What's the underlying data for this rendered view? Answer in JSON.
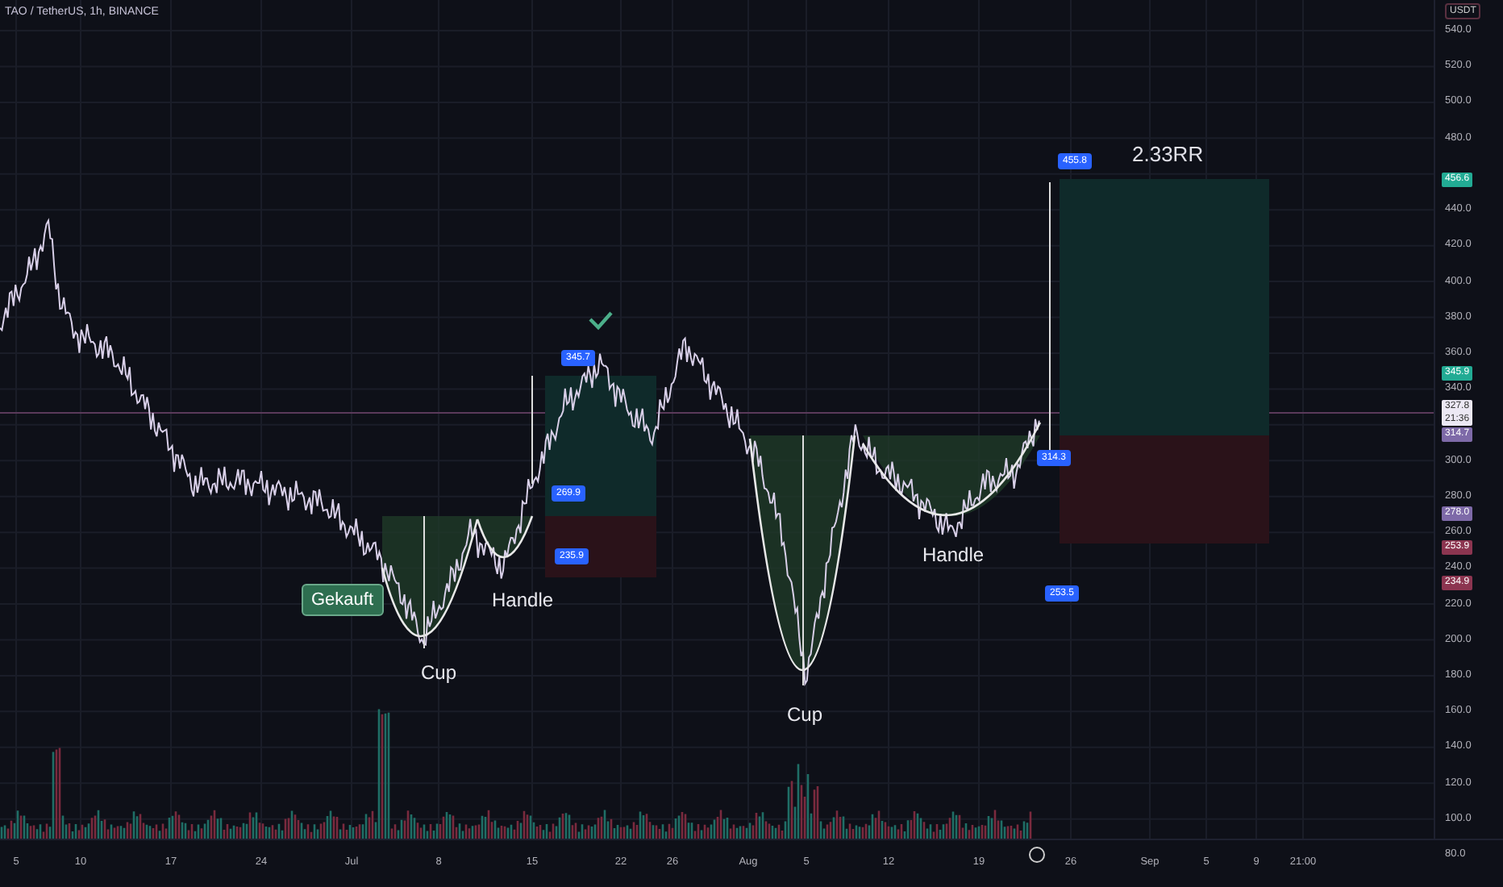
{
  "chart": {
    "title": "TAO / TetherUS, 1h, BINANCE",
    "rr_label": "2.33RR"
  },
  "price_axis": {
    "unit": "USDT",
    "ticks": [
      "540.0",
      "520.0",
      "500.0",
      "480.0",
      "440.0",
      "420.0",
      "400.0",
      "380.0",
      "360.0",
      "340.0",
      "300.0",
      "280.0",
      "260.0",
      "240.0",
      "220.0",
      "200.0",
      "180.0",
      "160.0",
      "140.0",
      "120.0",
      "100.0",
      "80.0"
    ],
    "badges": [
      {
        "text": "456.6",
        "color": "#22ab94"
      },
      {
        "text": "345.9",
        "color": "#22ab94"
      },
      {
        "text": "327.8",
        "subtext": "21:36",
        "color": "#ece8f4"
      },
      {
        "text": "314.7",
        "color": "#7e6aa8"
      },
      {
        "text": "278.0",
        "color": "#7e6aa8"
      },
      {
        "text": "253.9",
        "color": "#8c3550"
      },
      {
        "text": "234.9",
        "color": "#8c3550"
      }
    ]
  },
  "time_axis": {
    "ticks": [
      "5",
      "10",
      "17",
      "24",
      "Jul",
      "8",
      "15",
      "22",
      "26",
      "Aug",
      "5",
      "12",
      "19",
      "26",
      "Sep",
      "5",
      "9",
      "21:00"
    ]
  },
  "price_labels": [
    "345.7",
    "269.9",
    "235.9",
    "455.8",
    "314.3",
    "253.5"
  ],
  "annotations": [
    {
      "text": "Gekauft",
      "kind": "tag"
    },
    {
      "text": "Cup",
      "kind": "note"
    },
    {
      "text": "Handle",
      "kind": "note"
    },
    {
      "text": "Cup",
      "kind": "note"
    },
    {
      "text": "Handle",
      "kind": "note"
    }
  ]
}
